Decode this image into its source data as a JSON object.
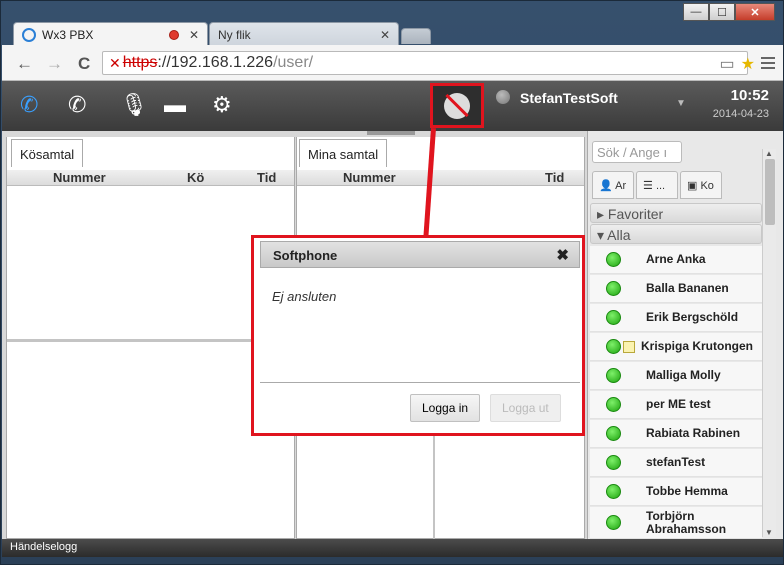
{
  "window": {
    "minimize": "—",
    "maximize": "☐",
    "close": "✕"
  },
  "tabs": [
    {
      "title": "Wx3 PBX",
      "close": "✕"
    },
    {
      "title": "Ny flik",
      "close": "✕"
    }
  ],
  "toolbar": {
    "back": "←",
    "forward": "→",
    "reload": "C",
    "url_scheme": "https",
    "url_host": "://192.168.1.226",
    "url_path": "/user/"
  },
  "app_header": {
    "user_name": "StefanTestSoft",
    "time": "10:52",
    "date": "2014-04-23"
  },
  "queue_panel": {
    "tab_label": "Kösamtal",
    "columns": [
      "Nummer",
      "Kö",
      "Tid"
    ]
  },
  "calls_panel": {
    "tab_label": "Mina samtal",
    "columns": [
      "Nummer",
      "Tid"
    ]
  },
  "contacts": {
    "search_placeholder": "Sök / Ange ı",
    "tabs": [
      "Ar",
      "...",
      "Ko"
    ],
    "groups": [
      "Favoriter",
      "Alla"
    ],
    "list": [
      {
        "name": "Arne Anka",
        "status_color": "#2fb41a",
        "note": false
      },
      {
        "name": "Balla Bananen",
        "status_color": "#2fb41a",
        "note": false
      },
      {
        "name": "Erik Bergschöld",
        "status_color": "#2fb41a",
        "note": false
      },
      {
        "name": "Krispiga Krutongen",
        "status_color": "#2fb41a",
        "note": true
      },
      {
        "name": "Malliga Molly",
        "status_color": "#2fb41a",
        "note": false
      },
      {
        "name": "per ME test",
        "status_color": "#2fb41a",
        "note": false
      },
      {
        "name": "Rabiata Rabinen",
        "status_color": "#2fb41a",
        "note": false
      },
      {
        "name": "stefanTest",
        "status_color": "#2fb41a",
        "note": false
      },
      {
        "name": "Tobbe Hemma",
        "status_color": "#2fb41a",
        "note": false
      },
      {
        "name": "Torbjörn Abrahamsson",
        "status_color": "#2fb41a",
        "note": false
      }
    ]
  },
  "footer": {
    "label": "Händelselogg"
  },
  "dialog": {
    "title": "Softphone",
    "close": "✖",
    "status": "Ej ansluten",
    "login": "Logga in",
    "logout": "Logga ut"
  },
  "colors": {
    "highlight": "#e0141e",
    "online": "#2fb41a",
    "header_bg": "#3a3a3a"
  }
}
